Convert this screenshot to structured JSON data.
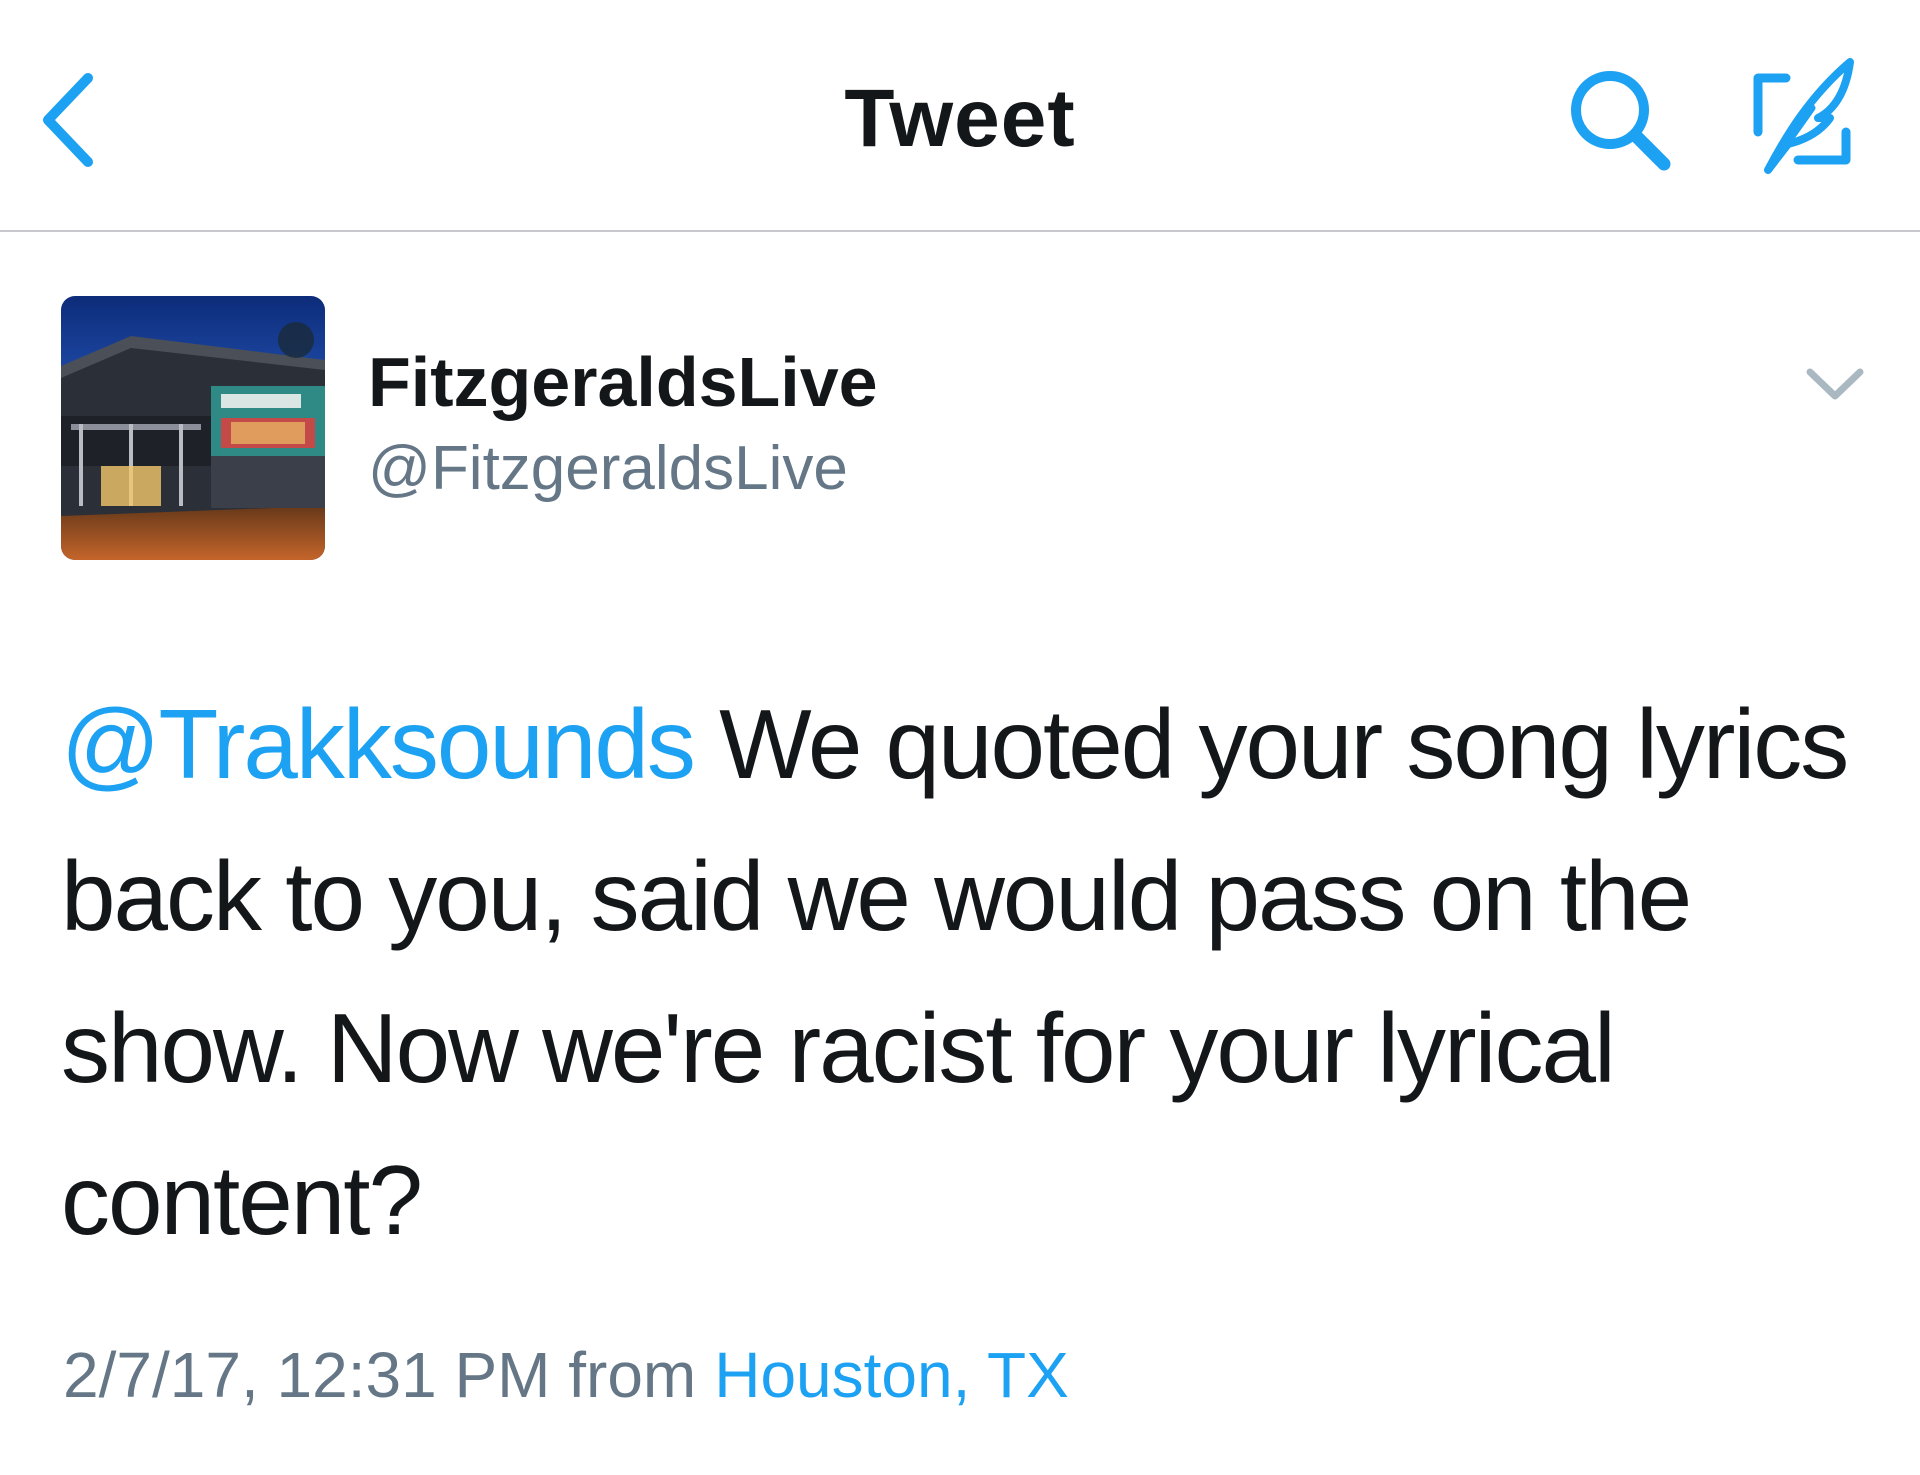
{
  "nav": {
    "title": "Tweet",
    "back_icon": "chevron-left-icon",
    "search_icon": "search-icon",
    "compose_icon": "compose-tweet-icon"
  },
  "tweet": {
    "display_name": "FitzgeraldsLive",
    "handle": "@FitzgeraldsLive",
    "mention": "@Trakksounds",
    "body": " We quoted your song lyrics back to you, said we would pass on the show. Now we're racist for your lyrical content?",
    "timestamp": "2/7/17, 12:31 PM from",
    "location": "Houston, TX",
    "more_icon": "chevron-down-icon"
  },
  "colors": {
    "accent": "#1da1f2",
    "text": "#14171a",
    "secondary": "#657786",
    "divider": "#c8c8cc"
  }
}
